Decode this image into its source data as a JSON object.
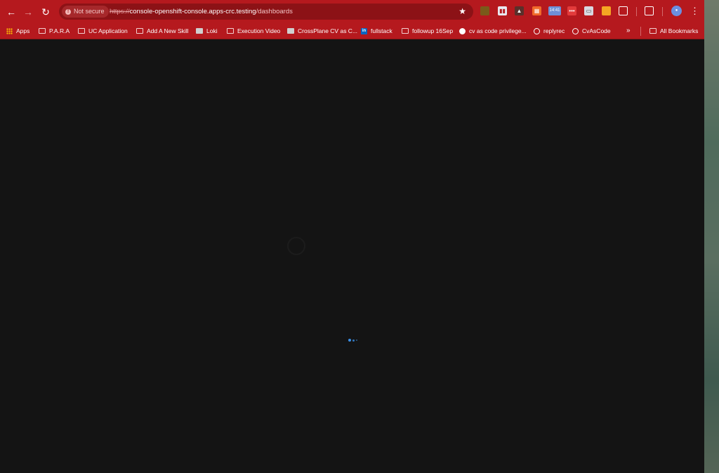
{
  "browser": {
    "nav": {
      "back_glyph": "←",
      "forward_glyph": "→",
      "reload_glyph": "↻"
    },
    "omnibox": {
      "security_label": "Not secure",
      "url_scheme": "https://",
      "url_host": "console-openshift-console.apps-crc.testing",
      "url_path": "/dashboards",
      "star_glyph": "★"
    },
    "extensions": {
      "badge_time": "14:41"
    },
    "menu_glyph": "⋮",
    "bookmarks": {
      "items": [
        {
          "label": "Apps"
        },
        {
          "label": "P.A.R.A"
        },
        {
          "label": "UC Application"
        },
        {
          "label": "Add A New Skill"
        },
        {
          "label": "Loki"
        },
        {
          "label": "Execution Video"
        },
        {
          "label": "CrossPlane CV as C..."
        },
        {
          "label": "fullstack"
        },
        {
          "label": "followup 16Sep"
        },
        {
          "label": "cv as code privilege..."
        },
        {
          "label": "replyrec"
        },
        {
          "label": "CvAsCode"
        }
      ],
      "more_glyph": "»",
      "all_bookmarks_label": "All Bookmarks"
    }
  },
  "colors": {
    "toolbar": "#b5191e",
    "omnibox": "#8c1216",
    "page_background": "#141414",
    "loader_dot": "#3a8ee6"
  }
}
